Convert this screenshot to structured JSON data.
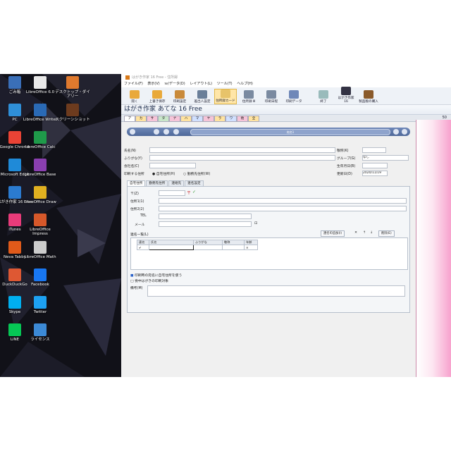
{
  "desktop": {
    "icons": [
      {
        "label": "ごみ箱",
        "icon": "recycle-bin-icon",
        "color": "#3a6fb8"
      },
      {
        "label": "LibreOffice 6.0",
        "icon": "libreoffice-icon",
        "color": "#e8e8e8"
      },
      {
        "label": "デスクトップ・ダイアリー",
        "icon": "diary-app-icon",
        "color": "#e07a2e"
      },
      {
        "label": "PC",
        "icon": "pc-icon",
        "color": "#2f8fd8"
      },
      {
        "label": "LibreOffice Writer",
        "icon": "writer-icon",
        "color": "#2a6ab5"
      },
      {
        "label": "スクリーンショット",
        "icon": "screenshot-icon",
        "color": "#6d3b1e"
      },
      {
        "label": "Google Chrome",
        "icon": "chrome-icon",
        "color": "#ea4335"
      },
      {
        "label": "LibreOffice Calc",
        "icon": "calc-icon",
        "color": "#1f9a4a"
      },
      {
        "label": "Microsoft Edge",
        "icon": "edge-icon",
        "color": "#1f8ad8"
      },
      {
        "label": "LibreOffice Base",
        "icon": "base-icon",
        "color": "#8a3fb0"
      },
      {
        "label": "はがき作家 16 Free",
        "icon": "hagaki-icon",
        "color": "#2b7bd0"
      },
      {
        "label": "LibreOffice Draw",
        "icon": "draw-icon",
        "color": "#e0b020"
      },
      {
        "label": "iTunes",
        "icon": "itunes-icon",
        "color": "#e83b7a"
      },
      {
        "label": "LibreOffice Impress",
        "icon": "impress-icon",
        "color": "#d6582a"
      },
      {
        "label": "Neva Tabby",
        "icon": "app-icon",
        "color": "#e05a1a"
      },
      {
        "label": "LibreOffice Math",
        "icon": "math-icon",
        "color": "#cccccc"
      },
      {
        "label": "DuckDuckGo",
        "icon": "duckduckgo-icon",
        "color": "#de5833"
      },
      {
        "label": "Facebook",
        "icon": "facebook-icon",
        "color": "#1877f2"
      },
      {
        "label": "Skype",
        "icon": "skype-icon",
        "color": "#00aff0"
      },
      {
        "label": "Twitter",
        "icon": "twitter-icon",
        "color": "#1da1f2"
      },
      {
        "label": "LINE",
        "icon": "line-icon",
        "color": "#06c755"
      },
      {
        "label": "ライセンス",
        "icon": "license-icon",
        "color": "#3c8ad6"
      }
    ]
  },
  "app": {
    "window_title": "はがき作家 16 Free - 住所録",
    "menu": [
      "ファイル(F)",
      "表示(V)",
      "ｗ/データ(D)",
      "レイアウト(L)",
      "ツール(T)",
      "ヘルプ(H)"
    ],
    "toolbar": [
      {
        "label": "開く",
        "icon": "folder-icon",
        "color": "#e9a93a"
      },
      {
        "label": "上書き保存",
        "icon": "save-icon",
        "color": "#e9a93a"
      },
      {
        "label": "印刷設定",
        "icon": "print-setup-icon",
        "color": "#c98a3a"
      },
      {
        "label": "差出人設定",
        "icon": "sender-icon",
        "color": "#6a7f99"
      },
      {
        "label": "住所録カード",
        "icon": "address-card-icon",
        "color": "#e7c36a",
        "selected": true
      },
      {
        "label": "住所録 Ⅲ",
        "icon": "address-book-icon",
        "color": "#7a8aa0"
      },
      {
        "label": "印刷日程",
        "icon": "print-schedule-icon",
        "color": "#7a8aa0"
      },
      {
        "label": "印刷データ",
        "icon": "print-data-icon",
        "color": "#6f88b8"
      },
      {
        "label": "終了",
        "icon": "exit-icon",
        "color": "#9bb"
      },
      {
        "label": "はがき作家 16",
        "icon": "hagaki-icon",
        "color": "#334"
      },
      {
        "label": "製品版の購入",
        "icon": "purchase-icon",
        "color": "#8a5a2a"
      }
    ],
    "heading": "はがき作家 あてな 16 Free",
    "tab_count": "50",
    "record_nav": "宛名1",
    "tab_colors": [
      "#ffffff",
      "#ffe3a0",
      "#f6c4d8",
      "#c8e6c9",
      "#f6c4d8",
      "#ffe3a0",
      "#d0e0ff",
      "#f6c4d8",
      "#ffe3a0",
      "#d0e0ff",
      "#f6c4d8",
      "#ffe3a0"
    ],
    "tab_letters": [
      "ア",
      "カ",
      "サ",
      "タ",
      "ナ",
      "ハ",
      "マ",
      "ヤ",
      "ラ",
      "ワ",
      "他",
      "全"
    ]
  },
  "form": {
    "name_label": "氏名(N)",
    "kana_label": "ふりがな(Y)",
    "company_label": "会社名(C)",
    "mail_label": "印刷する住所",
    "radio_home": "自宅住所(H)",
    "radio_work": "勤務先住所(W)",
    "honorific_label": "敬称(K)",
    "group_label": "グループ(G)",
    "group_value": "なし",
    "birth_label": "生年月日(B)",
    "updated_label": "更新日(D)",
    "updated_value": "2020/11/19",
    "subtabs": [
      "自宅住所",
      "勤務先住所",
      "連絡先",
      "連名設定"
    ],
    "zip_label": "〒(Z)",
    "addr1_label": "住所1(1)",
    "addr2_label": "住所2(2)",
    "tel_label": "TEL",
    "mail2_label": "メール",
    "renmei_label": "連名一覧(L)",
    "add_btn": "連名の追加(I)",
    "del_btn": "削除(E)",
    "grid_headers": [
      "連名",
      "氏名",
      "ふりがな",
      "敬称",
      "年齢"
    ],
    "check1": "印刷時の宛名に自宅住所を使う",
    "check2": "喪中はがきの印刷対象",
    "memo_label": "備考(M)"
  }
}
